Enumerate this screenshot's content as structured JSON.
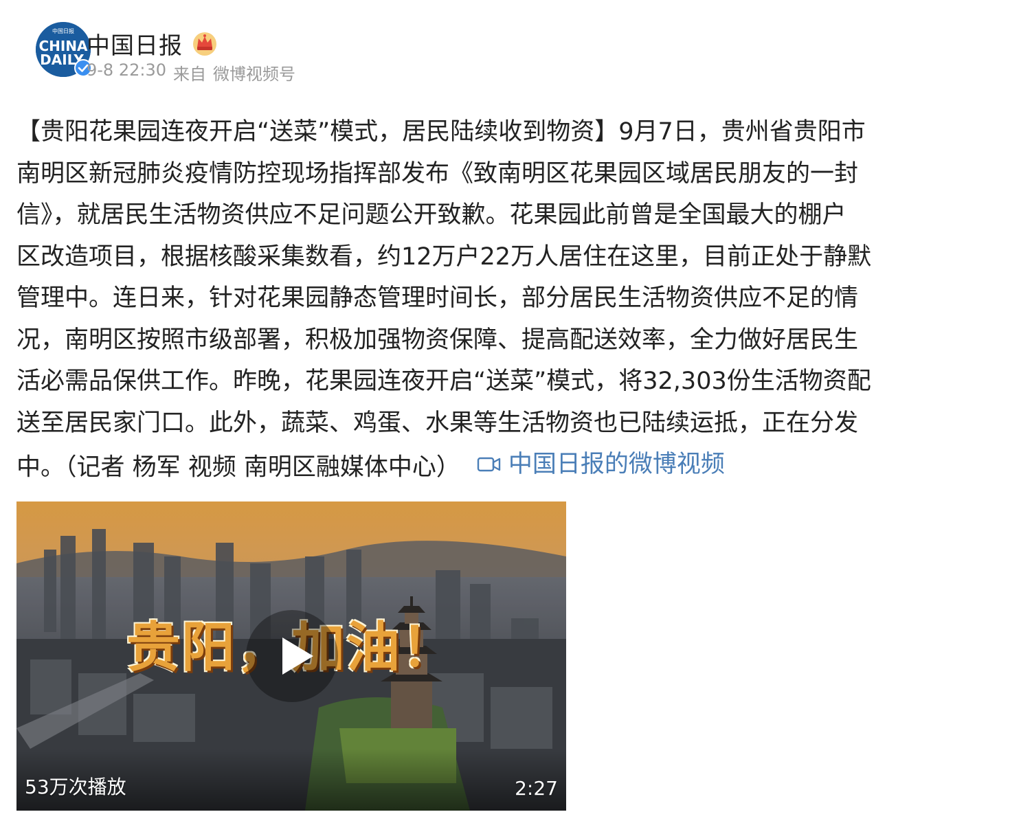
{
  "header": {
    "avatar_text_top": "中国日报",
    "avatar_text_line1": "CHINA",
    "avatar_text_line2": "DAILY",
    "user_name": "中国日报",
    "timestamp": "9-8 22:30",
    "source_prefix": "来自",
    "source_name": "微博视频号",
    "badge_icon": "crown-icon",
    "verified_icon": "verified-badge-icon"
  },
  "post": {
    "lines": [
      "【贵阳花果园连夜开启“送菜”模式，居民陆续收到物资】9月7日，贵州省贵阳市",
      "南明区新冠肺炎疫情防控现场指挥部发布《致南明区花果园区域居民朋友的一封",
      "信》，就居民生活物资供应不足问题公开致歉。花果园此前曾是全国最大的棚户",
      "区改造项目，根据核酸采集数看，约12万户22万人居住在这里，目前正处于静默",
      "管理中。连日来，针对花果园静态管理时间长，部分居民生活物资供应不足的情",
      "况，南明区按照市级部署，积极加强物资保障、提高配送效率，全力做好居民生",
      "活必需品保供工作。昨晚，花果园连夜开启“送菜”模式，将32,303份生活物资配",
      "送至居民家门口。此外，蔬菜、鸡蛋、水果等生活物资也已陆续运抵，正在分发"
    ],
    "last_line": "中。（记者 杨军 视频 南明区融媒体中心）",
    "video_link_label": "中国日报的微博视频"
  },
  "video": {
    "overlay_title": "贵阳，加油！",
    "views": "53万次播放",
    "duration": "2:27"
  },
  "colors": {
    "link": "#4a7eb7",
    "meta": "#9a9a9a",
    "text": "#222222"
  }
}
